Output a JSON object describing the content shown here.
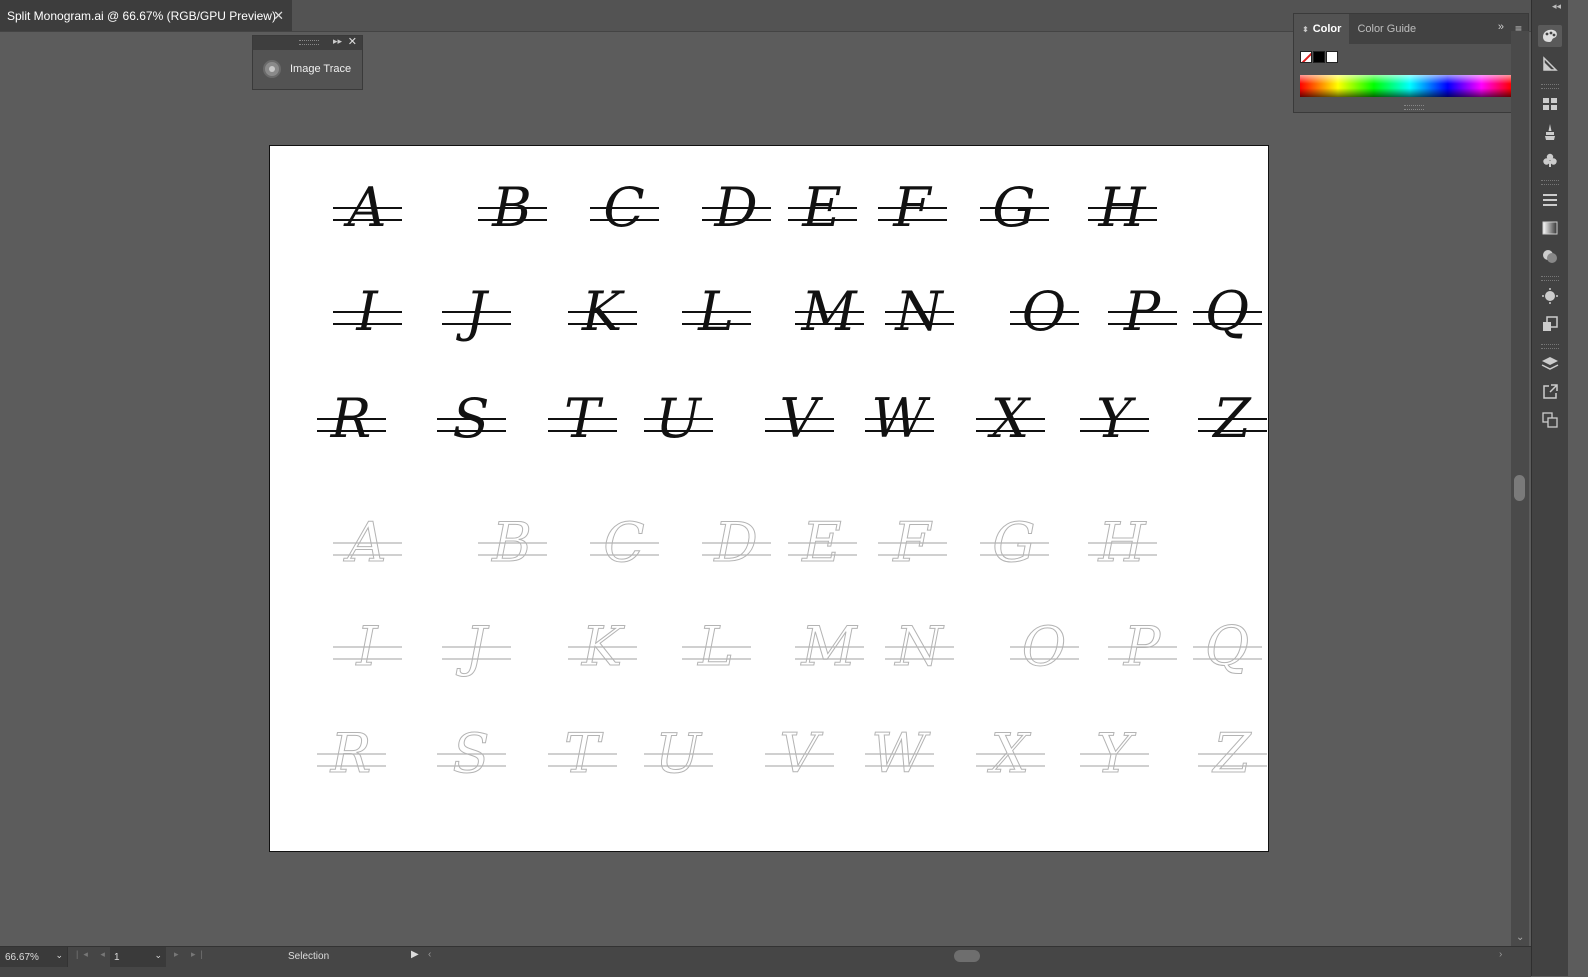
{
  "document": {
    "tab_title": "Split Monogram.ai @ 66.67% (RGB/GPU Preview)",
    "close_glyph": "✕"
  },
  "image_trace_panel": {
    "label": "Image Trace",
    "icon": "image-trace-icon",
    "collapse_glyph": "▸▸",
    "close_glyph": "✕"
  },
  "color_panel": {
    "tabs": [
      "Color",
      "Color Guide"
    ],
    "active_tab": "Color",
    "expand_glyph": "»",
    "menu_glyph": "≡",
    "swatches": [
      "none",
      "black",
      "white"
    ],
    "spectrum_colors": [
      "#ff0000",
      "#ffff00",
      "#00ff00",
      "#00ffff",
      "#0000ff",
      "#ff00ff",
      "#ff0000"
    ]
  },
  "right_dock": {
    "collapse_glyph": "◂◂",
    "tools": [
      "color-panel-icon",
      "color-guide-icon",
      "swatches-icon",
      "brushes-icon",
      "symbols-icon",
      "stroke-icon",
      "gradient-icon",
      "transparency-icon",
      "appearance-icon",
      "graphic-styles-icon",
      "layers-icon",
      "asset-export-icon",
      "artboards-icon"
    ]
  },
  "artboard": {
    "background": "#ffffff",
    "solid_color": "#111111",
    "outline_color": "#b4b4b4",
    "rows": [
      [
        "A",
        "B",
        "C",
        "D",
        "E",
        "F",
        "G",
        "H"
      ],
      [
        "I",
        "J",
        "K",
        "L",
        "M",
        "N",
        "O",
        "P",
        "Q"
      ],
      [
        "R",
        "S",
        "T",
        "U",
        "V",
        "W",
        "X",
        "Y",
        "Z"
      ],
      [
        "A",
        "B",
        "C",
        "D",
        "E",
        "F",
        "G",
        "H"
      ],
      [
        "I",
        "J",
        "K",
        "L",
        "M",
        "N",
        "O",
        "P",
        "Q"
      ],
      [
        "R",
        "S",
        "T",
        "U",
        "V",
        "W",
        "X",
        "Y",
        "Z"
      ]
    ]
  },
  "statusbar": {
    "zoom": "66.67%",
    "page": "1",
    "tool": "Selection",
    "dropdown_glyph": "⌄",
    "first_prev": "|◂ ◂",
    "next_last": "▸ ▸|",
    "play_glyph": "▶",
    "scroll_left": "‹",
    "scroll_right": "›"
  },
  "vertical_scroll": {
    "down_glyph": "⌄"
  }
}
